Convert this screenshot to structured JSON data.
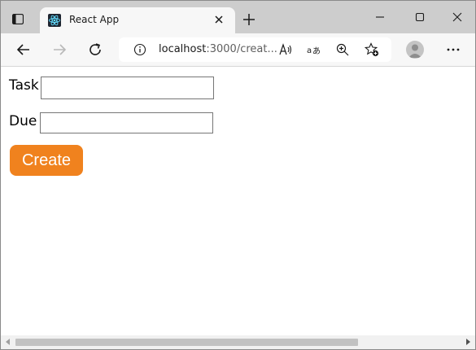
{
  "browser": {
    "tab": {
      "title": "React App",
      "favicon_icon": "react-icon"
    },
    "address": {
      "host": "localhost",
      "rest": ":3000/creat..."
    },
    "icons": {
      "tab_actions": "tab-actions-icon",
      "close_tab": "close-icon",
      "new_tab": "plus-icon",
      "minimize": "minimize-icon",
      "maximize": "maximize-icon",
      "close_window": "close-icon",
      "back": "arrow-left-icon",
      "forward": "arrow-right-icon",
      "refresh": "refresh-icon",
      "site_info": "info-icon",
      "read_aloud": "read-aloud-icon",
      "translate": "translate-icon",
      "zoom": "zoom-in-icon",
      "favorites": "star-add-icon",
      "profile": "profile-icon",
      "more": "more-icon"
    }
  },
  "form": {
    "task_label": "Task",
    "task_value": "",
    "due_label": "Due",
    "due_value": "",
    "create_label": "Create",
    "create_color": "#f0821e"
  }
}
